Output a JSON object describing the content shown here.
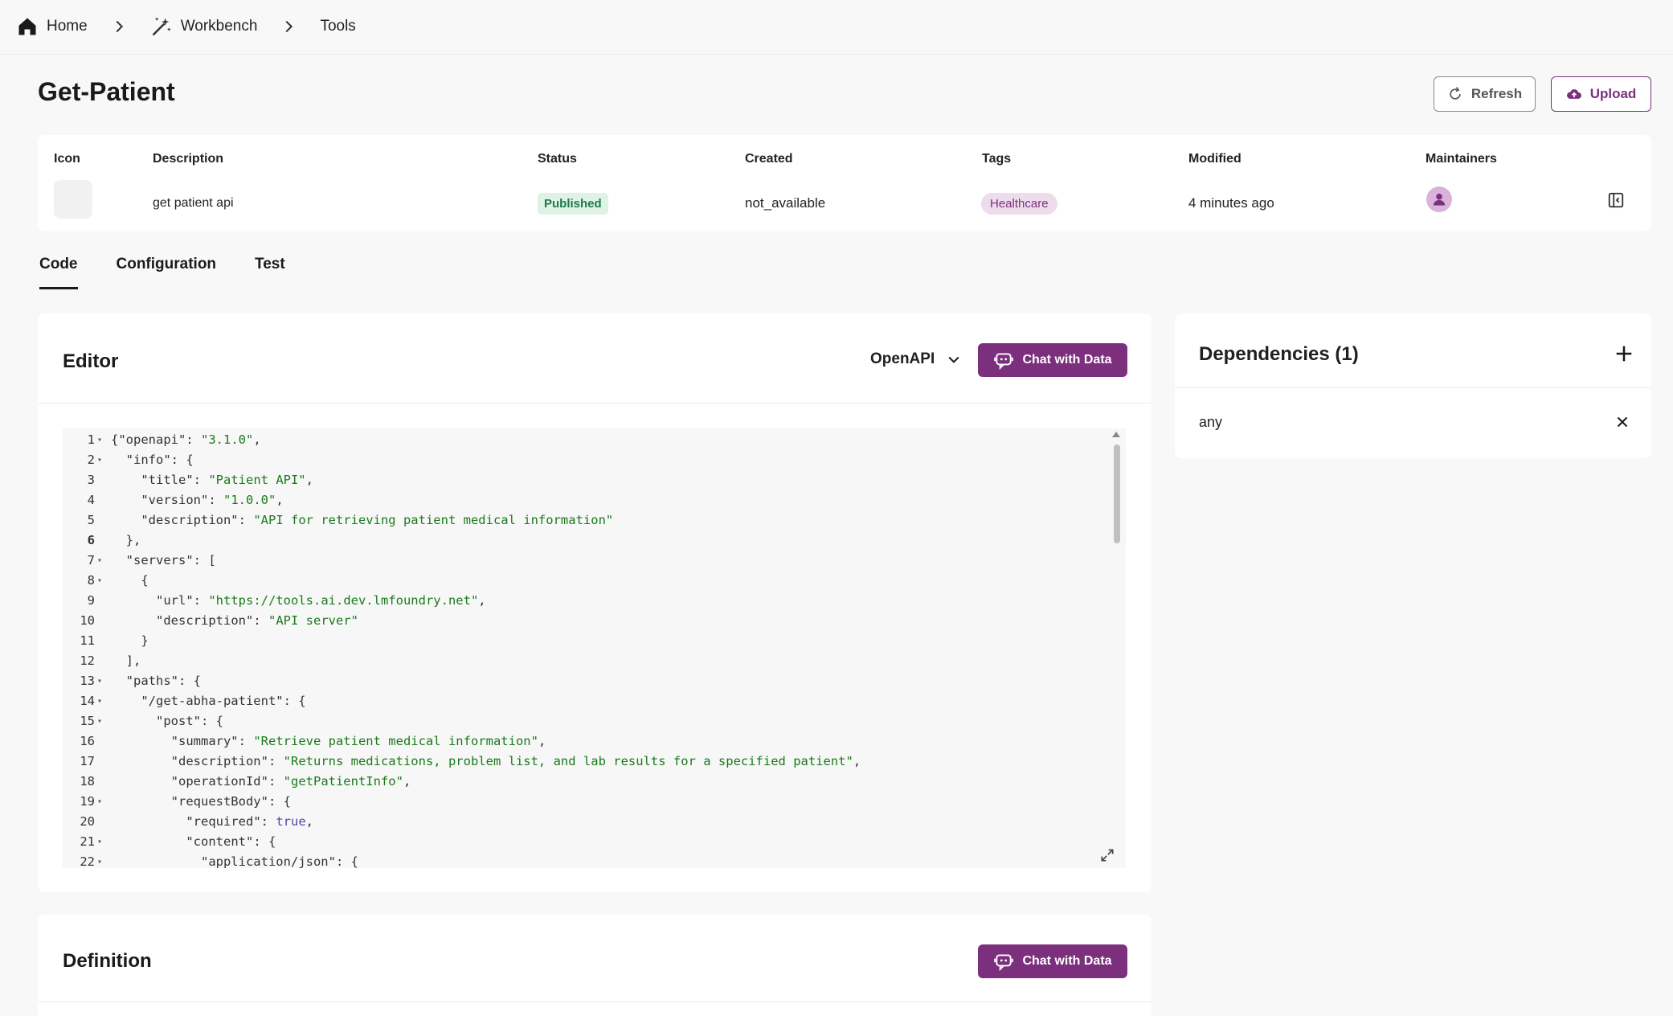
{
  "breadcrumb": {
    "home": "Home",
    "workbench": "Workbench",
    "tools": "Tools"
  },
  "page": {
    "title": "Get-Patient",
    "refresh_label": "Refresh",
    "upload_label": "Upload"
  },
  "info": {
    "headers": {
      "icon": "Icon",
      "description": "Description",
      "status": "Status",
      "created": "Created",
      "tags": "Tags",
      "modified": "Modified",
      "maintainers": "Maintainers"
    },
    "description": "get patient api",
    "status": "Published",
    "created": "not_available",
    "tag": "Healthcare",
    "modified": "4 minutes ago"
  },
  "tabs": [
    "Code",
    "Configuration",
    "Test"
  ],
  "editor": {
    "title": "Editor",
    "format": "OpenAPI",
    "chat_label": "Chat with Data",
    "lines": [
      {
        "n": "1",
        "fold": true,
        "code": "{\"openapi\": \"3.1.0\","
      },
      {
        "n": "2",
        "fold": true,
        "code": "  \"info\": {"
      },
      {
        "n": "3",
        "fold": false,
        "code": "    \"title\": \"Patient API\","
      },
      {
        "n": "4",
        "fold": false,
        "code": "    \"version\": \"1.0.0\","
      },
      {
        "n": "5",
        "fold": false,
        "code": "    \"description\": \"API for retrieving patient medical information\""
      },
      {
        "n": "6",
        "fold": false,
        "code": "  },"
      },
      {
        "n": "7",
        "fold": true,
        "code": "  \"servers\": ["
      },
      {
        "n": "8",
        "fold": true,
        "code": "    {"
      },
      {
        "n": "9",
        "fold": false,
        "code": "      \"url\": \"https://tools.ai.dev.lmfoundry.net\","
      },
      {
        "n": "10",
        "fold": false,
        "code": "      \"description\": \"API server\""
      },
      {
        "n": "11",
        "fold": false,
        "code": "    }"
      },
      {
        "n": "12",
        "fold": false,
        "code": "  ],"
      },
      {
        "n": "13",
        "fold": true,
        "code": "  \"paths\": {"
      },
      {
        "n": "14",
        "fold": true,
        "code": "    \"/get-abha-patient\": {"
      },
      {
        "n": "15",
        "fold": true,
        "code": "      \"post\": {"
      },
      {
        "n": "16",
        "fold": false,
        "code": "        \"summary\": \"Retrieve patient medical information\","
      },
      {
        "n": "17",
        "fold": false,
        "code": "        \"description\": \"Returns medications, problem list, and lab results for a specified patient\","
      },
      {
        "n": "18",
        "fold": false,
        "code": "        \"operationId\": \"getPatientInfo\","
      },
      {
        "n": "19",
        "fold": true,
        "code": "        \"requestBody\": {"
      },
      {
        "n": "20",
        "fold": false,
        "code": "          \"required\": true,"
      },
      {
        "n": "21",
        "fold": true,
        "code": "          \"content\": {"
      },
      {
        "n": "22",
        "fold": true,
        "code": "            \"application/json\": {"
      }
    ]
  },
  "dependencies": {
    "title": "Dependencies (1)",
    "items": [
      "any"
    ]
  },
  "definition": {
    "title": "Definition",
    "chat_label": "Chat with Data"
  },
  "colors": {
    "accent": "#7b2f7d",
    "published_bg": "#dff2e6",
    "tag_bg": "#ecdcec"
  }
}
